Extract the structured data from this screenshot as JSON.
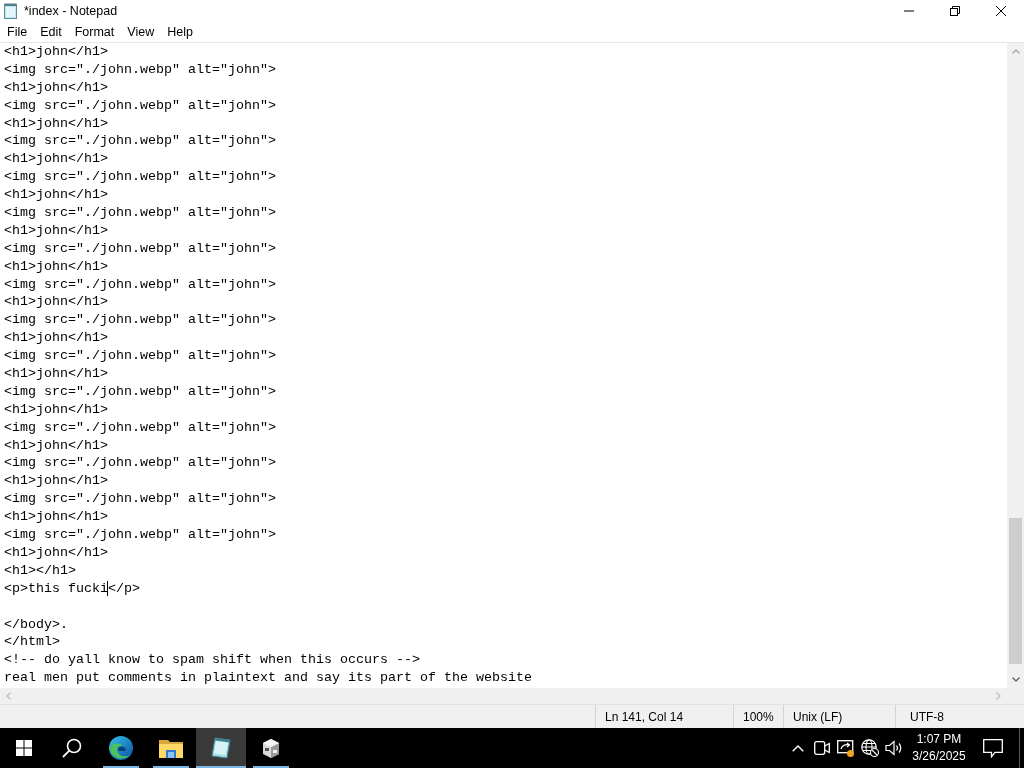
{
  "window": {
    "title": "*index - Notepad"
  },
  "menu": [
    "File",
    "Edit",
    "Format",
    "View",
    "Help"
  ],
  "editor": {
    "lines": [
      {
        "kind": "text",
        "text": "<h1>john</h1>"
      },
      {
        "kind": "text",
        "text": "<img src=\"./john.webp\" alt=\"john\">"
      },
      {
        "kind": "text",
        "text": "<h1>john</h1>"
      },
      {
        "kind": "text",
        "text": "<img src=\"./john.webp\" alt=\"john\">"
      },
      {
        "kind": "text",
        "text": "<h1>john</h1>"
      },
      {
        "kind": "text",
        "text": "<img src=\"./john.webp\" alt=\"john\">"
      },
      {
        "kind": "text",
        "text": "<h1>john</h1>"
      },
      {
        "kind": "text",
        "text": "<img src=\"./john.webp\" alt=\"john\">"
      },
      {
        "kind": "text",
        "text": "<h1>john</h1>"
      },
      {
        "kind": "text",
        "text": "<img src=\"./john.webp\" alt=\"john\">"
      },
      {
        "kind": "text",
        "text": "<h1>john</h1>"
      },
      {
        "kind": "text",
        "text": "<img src=\"./john.webp\" alt=\"john\">"
      },
      {
        "kind": "text",
        "text": "<h1>john</h1>"
      },
      {
        "kind": "text",
        "text": "<img src=\"./john.webp\" alt=\"john\">"
      },
      {
        "kind": "text",
        "text": "<h1>john</h1>"
      },
      {
        "kind": "text",
        "text": "<img src=\"./john.webp\" alt=\"john\">"
      },
      {
        "kind": "text",
        "text": "<h1>john</h1>"
      },
      {
        "kind": "text",
        "text": "<img src=\"./john.webp\" alt=\"john\">"
      },
      {
        "kind": "text",
        "text": "<h1>john</h1>"
      },
      {
        "kind": "text",
        "text": "<img src=\"./john.webp\" alt=\"john\">"
      },
      {
        "kind": "text",
        "text": "<h1>john</h1>"
      },
      {
        "kind": "text",
        "text": "<img src=\"./john.webp\" alt=\"john\">"
      },
      {
        "kind": "text",
        "text": "<h1>john</h1>"
      },
      {
        "kind": "text",
        "text": "<img src=\"./john.webp\" alt=\"john\">"
      },
      {
        "kind": "text",
        "text": "<h1>john</h1>"
      },
      {
        "kind": "text",
        "text": "<img src=\"./john.webp\" alt=\"john\">"
      },
      {
        "kind": "text",
        "text": "<h1>john</h1>"
      },
      {
        "kind": "text",
        "text": "<img src=\"./john.webp\" alt=\"john\">"
      },
      {
        "kind": "text",
        "text": "<h1>john</h1>"
      },
      {
        "kind": "text",
        "text": "<h1></h1>"
      },
      {
        "kind": "caret",
        "before": "<p>this fucki",
        "after": "</p>"
      },
      {
        "kind": "blank"
      },
      {
        "kind": "text",
        "text": "</body>."
      },
      {
        "kind": "text",
        "text": "</html>"
      },
      {
        "kind": "text",
        "text": "<!-- do yall know to spam shift when this occurs -->"
      },
      {
        "kind": "text",
        "text": "real men put comments in plaintext and say its part of the website"
      }
    ]
  },
  "status_bar": {
    "position": "Ln 141, Col 14",
    "zoom": "100%",
    "line_ending": "Unix (LF)",
    "encoding": "UTF-8"
  },
  "taskbar": {
    "apps": [
      {
        "kind": "browser",
        "running": true,
        "selected": false
      },
      {
        "kind": "folder",
        "running": true,
        "selected": false
      },
      {
        "kind": "notepad",
        "running": true,
        "selected": true
      },
      {
        "kind": "cabinet",
        "running": true,
        "selected": false
      }
    ],
    "clock": {
      "time": "1:07 PM",
      "date": "3/26/2025"
    }
  }
}
